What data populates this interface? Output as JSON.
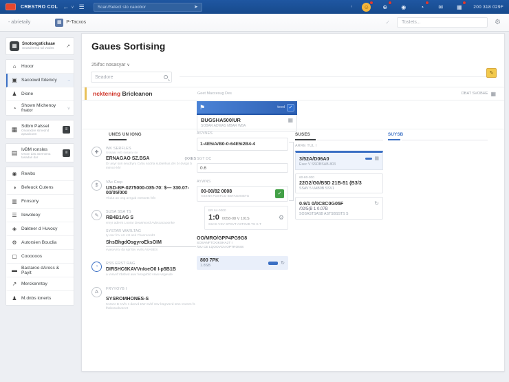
{
  "colors": {
    "topbar": "#1b4e95",
    "accent": "#3a6fc4",
    "red": "#cf3327",
    "amber": "#e8c15a",
    "green": "#43a047",
    "yellow_button": "#f2c94c"
  },
  "topbar": {
    "brand": "CRESTRO COL",
    "search_placeholder": "Scan/Select sto caoobor",
    "status": "200 318 029F"
  },
  "toolbar": {
    "breadcrumb": "- abrietaily",
    "app_chip": "P-Tacxos",
    "app_chip_icon": "▦",
    "search_placeholder": "Toslets...",
    "gear_icon": "⚙"
  },
  "sidebar": {
    "profile": {
      "name": "Snotongstickaae",
      "desc": "Snasdversd sd vwdss",
      "icon": "▦",
      "arrow": "↗"
    },
    "items": [
      {
        "label": "Hooor",
        "icon": "⌂"
      },
      {
        "label": "Sacoowd fotenicy",
        "icon": "▣",
        "trail": "–"
      },
      {
        "label": "Dione",
        "icon": "♟"
      },
      {
        "label": "Shown Michenoy fnator",
        "icon": "◔",
        "trail": "∨"
      },
      {
        "label": "Sdbm Palssel",
        "desc": "Orvanxbre stmednd apsadconn",
        "icon": "▦",
        "badge": "≡"
      },
      {
        "label": "IvBM ronsles",
        "desc": "Orvan das asemsma tasadan dar",
        "icon": "▤",
        "badge": "≡"
      },
      {
        "label": "Rewbs",
        "icon": "◉"
      },
      {
        "label": "Befeuck Cutens",
        "icon": "◑"
      },
      {
        "label": "Fnnsony",
        "icon": "▥"
      },
      {
        "label": "Ilewoleoy",
        "icon": "☰"
      },
      {
        "label": "Dakteer d Huvocy",
        "icon": "◈"
      },
      {
        "label": "Autorsien Bouclia",
        "icon": "⚙"
      },
      {
        "label": "Coooooos",
        "icon": "▢"
      },
      {
        "label": "Bactaroo dAross & Payit",
        "icon": "▬"
      },
      {
        "label": "Merckenntoy",
        "icon": "↗"
      },
      {
        "label": "M.dnbs ionerts",
        "icon": "♟"
      }
    ]
  },
  "main": {
    "title": "Gaues Sortising",
    "per_page": "25/foc nosasyar",
    "search_placeholder": "Seadore",
    "edit_button_icon": "✎",
    "header_row": {
      "name_red": "ncktening",
      "name_dark": "Bricleanon",
      "note": "Geet Maxcesug Des",
      "action": "DBAT SVOBHE",
      "action_icon": "▦"
    },
    "banner": {
      "flag_icon": "⚑",
      "tag": "teed",
      "check": "✓",
      "title": "BUGSHA500/UR",
      "subtitle": "SOBAR ADWAS MBAR WBA",
      "icon": "▦"
    },
    "tabs": {
      "left": "UNES UN IONG",
      "right": "SUSES",
      "far": "SUYSB"
    },
    "steps": [
      {
        "icon": "✚",
        "label": "WK SERFLES",
        "note": "Ussaar vvb svsasv sv",
        "value": "ERNAGAO SZ.BSA",
        "right": "(XXES",
        "desc": "Dr asyr syri seudryru Cvbu sodrta subterkus drv br dvsgs b msvce khr"
      },
      {
        "icon": "$",
        "label": "VAc Crep",
        "value": "USD-BF-0275000-035-70: $— 330.07-00/05/000",
        "desc": "Vkdut an ong avrgub vreswrts fsfv"
      },
      {
        "icon": "✎",
        "label": "SUSA SSA TS",
        "value": "RB4B1AG S",
        "desc": "vmyr aderrs Lnorar Deasrword Avbscacaoonke"
      },
      {
        "icon": "◔",
        "label": "RSS ERST RAG",
        "value": "DIRSHC6KAVVnIoeO0 I-p5B1B",
        "desc": "a vvsvvf Vbsfwd awv fvsvgvbfd vsvw vsgevde"
      },
      {
        "icon": "A",
        "label": "FRYYOYB I",
        "value": "SYSROMHONES-S",
        "desc": "Kssvsr B srvfv s davvd DW Svbf Ssv bsgrvsvd srss vsvwrs fs fhsbssvdrvsrvrt"
      }
    ],
    "substep": {
      "label": "SYSTAR WARLTAG",
      "note": "ty asv frtv uS vst asd Fhasmeedtt",
      "value": "ShsBhgdOsgyroEksOIM",
      "desc": "vvasvvrsv da sprrtsv vvrts ASASES"
    },
    "mid": {
      "asynes_label": "ASYNES",
      "code": "1-4E5iA/B0-0-64E5i2B4-4",
      "sgt_label": "SGT DC",
      "sgt_value": "0.6",
      "aywns_label": "AYWNS",
      "card1": {
        "title": "00-00/82 0008",
        "sub": "ASSNA FOSTCO BSTASANSTS",
        "check": "✓"
      },
      "card2": {
        "head": "BR 64-0000",
        "big": "1:0",
        "side": "0058-08 V 101S",
        "line": "SSAS VSV SPSVT ASTSVB TS S.T",
        "gear_icon": "⚙"
      },
      "block": {
        "title": "OO/MRO/GPP4PG9G8",
        "line1": "SOSANFTCKIKSHA2T I",
        "line2": "/OU CE LQOOVCN OPTRONIS"
      },
      "hlrow": {
        "title": "800 7PK",
        "sub": "1.8SB",
        "icon": "↻"
      }
    },
    "right": {
      "label": "ARRE TUL I",
      "card1": {
        "title": "3/52A/D06A0",
        "sub": "Exec V SSOBSAB-803",
        "icon": "▦"
      },
      "card2": {
        "head": "60-80-300",
        "title": "22G2/G0/B5D 21B-51 (B3/3",
        "sub": "SSAV 5 UAB0B SSV1"
      },
      "card3": {
        "title": "0.9/1 0/0C8C0G05F",
        "line": "/02/5(B 1 0.07B",
        "sub": "SOSASTSASB ASTSBSSTS S",
        "icon": "↻"
      }
    }
  }
}
